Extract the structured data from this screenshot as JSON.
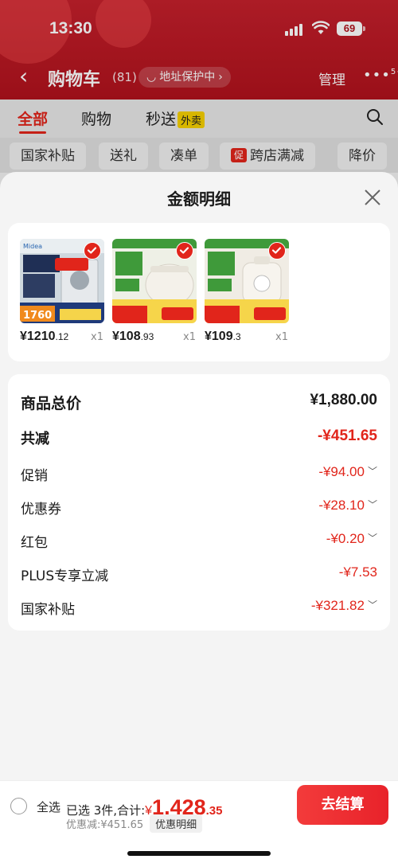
{
  "status": {
    "time": "13:30",
    "battery": "69"
  },
  "nav": {
    "back": "‹",
    "title": "购物车",
    "count": "(81)",
    "address": "地址保护中",
    "manage": "管理",
    "more": "•••",
    "more_badge": "5+"
  },
  "tabs": [
    {
      "label": "全部"
    },
    {
      "label": "购物"
    },
    {
      "label": "秒送",
      "badge": "外卖"
    }
  ],
  "chips": [
    "国家补贴",
    "送礼",
    "凑单",
    "跨店满减",
    "降价"
  ],
  "chip_promo_icon": "促",
  "sheet": {
    "title": "金额明细"
  },
  "products": [
    {
      "price_int": "¥1210",
      "price_dec": ".12",
      "qty": "x1",
      "image": "midea-appliance"
    },
    {
      "price_int": "¥108",
      "price_dec": ".93",
      "qty": "x1",
      "image": "rice-cooker"
    },
    {
      "price_int": "¥109",
      "price_dec": ".3",
      "qty": "x1",
      "image": "pressure-cooker"
    }
  ],
  "summary": {
    "total": {
      "label": "商品总价",
      "value": "¥1,880.00"
    },
    "reduce": {
      "label": "共减",
      "value": "-¥451.65"
    },
    "items": [
      {
        "label": "促销",
        "value": "-¥94.00",
        "expandable": true
      },
      {
        "label": "优惠券",
        "value": "-¥28.10",
        "expandable": true
      },
      {
        "label": "红包",
        "value": "-¥0.20",
        "expandable": true
      },
      {
        "label": "PLUS专享立减",
        "value": "-¥7.53",
        "expandable": false
      },
      {
        "label": "国家补贴",
        "value": "-¥321.82",
        "expandable": true
      }
    ]
  },
  "bottom": {
    "select_all": "全选",
    "selected_text": "已选 3件,合计:",
    "currency": "¥",
    "grand_int": "1,428",
    "grand_dec": ".35",
    "discount_text": "优惠减:¥451.65",
    "detail_label": "优惠明细",
    "checkout": "去结算"
  },
  "colors": {
    "accent": "#e1251b",
    "header": "#b0121c"
  }
}
